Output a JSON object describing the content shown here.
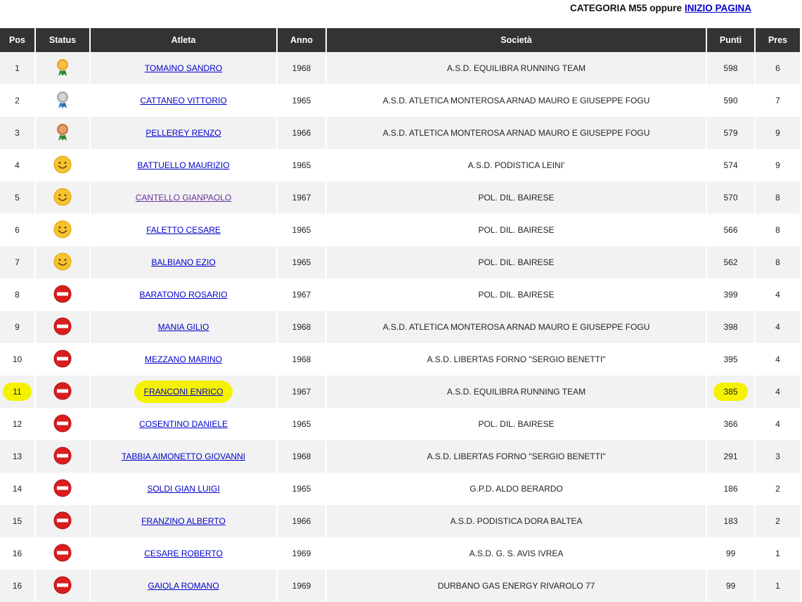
{
  "header": {
    "category_text": "CATEGORIA M55 oppure",
    "top_link": "INIZIO PAGINA"
  },
  "columns": [
    "Pos",
    "Status",
    "Atleta",
    "Anno",
    "Società",
    "Punti",
    "Pres"
  ],
  "rows": [
    {
      "pos": "1",
      "status": "gold-medal-icon",
      "athlete": "TOMAINO SANDRO",
      "year": "1968",
      "club": "A.S.D. EQUILIBRA RUNNING TEAM",
      "points": "598",
      "pres": "6"
    },
    {
      "pos": "2",
      "status": "silver-medal-icon",
      "athlete": "CATTANEO VITTORIO",
      "year": "1965",
      "club": "A.S.D. ATLETICA MONTEROSA ARNAD MAURO E GIUSEPPE FOGU",
      "points": "590",
      "pres": "7"
    },
    {
      "pos": "3",
      "status": "bronze-medal-icon",
      "athlete": "PELLEREY RENZO",
      "year": "1966",
      "club": "A.S.D. ATLETICA MONTEROSA ARNAD MAURO E GIUSEPPE FOGU",
      "points": "579",
      "pres": "9"
    },
    {
      "pos": "4",
      "status": "smiley-icon",
      "athlete": "BATTUELLO MAURIZIO",
      "year": "1965",
      "club": "A.S.D. PODISTICA LEINI'",
      "points": "574",
      "pres": "9"
    },
    {
      "pos": "5",
      "status": "smiley-icon",
      "athlete": "CANTELLO GIANPAOLO",
      "year": "1967",
      "club": "POL. DIL. BAIRESE",
      "points": "570",
      "pres": "8",
      "visited": true
    },
    {
      "pos": "6",
      "status": "smiley-icon",
      "athlete": "FALETTO CESARE",
      "year": "1965",
      "club": "POL. DIL. BAIRESE",
      "points": "566",
      "pres": "8"
    },
    {
      "pos": "7",
      "status": "smiley-icon",
      "athlete": "BALBIANO EZIO",
      "year": "1965",
      "club": "POL. DIL. BAIRESE",
      "points": "562",
      "pres": "8"
    },
    {
      "pos": "8",
      "status": "no-entry-icon",
      "athlete": "BARATONO ROSARIO",
      "year": "1967",
      "club": "POL. DIL. BAIRESE",
      "points": "399",
      "pres": "4"
    },
    {
      "pos": "9",
      "status": "no-entry-icon",
      "athlete": "MANIA GILIO",
      "year": "1968",
      "club": "A.S.D. ATLETICA MONTEROSA ARNAD MAURO E GIUSEPPE FOGU",
      "points": "398",
      "pres": "4"
    },
    {
      "pos": "10",
      "status": "no-entry-icon",
      "athlete": "MEZZANO MARINO",
      "year": "1968",
      "club": "A.S.D. LIBERTAS FORNO \"SERGIO BENETTI\"",
      "points": "395",
      "pres": "4"
    },
    {
      "pos": "11",
      "status": "no-entry-icon",
      "athlete": "FRANCONI ENRICO",
      "year": "1967",
      "club": "A.S.D. EQUILIBRA RUNNING TEAM",
      "points": "385",
      "pres": "4",
      "highlighted": true
    },
    {
      "pos": "12",
      "status": "no-entry-icon",
      "athlete": "COSENTINO DANIELE",
      "year": "1965",
      "club": "POL. DIL. BAIRESE",
      "points": "366",
      "pres": "4"
    },
    {
      "pos": "13",
      "status": "no-entry-icon",
      "athlete": "TABBIA AIMONETTO GIOVANNI",
      "year": "1968",
      "club": "A.S.D. LIBERTAS FORNO \"SERGIO BENETTI\"",
      "points": "291",
      "pres": "3"
    },
    {
      "pos": "14",
      "status": "no-entry-icon",
      "athlete": "SOLDI GIAN LUIGI",
      "year": "1965",
      "club": "G.P.D. ALDO BERARDO",
      "points": "186",
      "pres": "2"
    },
    {
      "pos": "15",
      "status": "no-entry-icon",
      "athlete": "FRANZINO ALBERTO",
      "year": "1966",
      "club": "A.S.D. PODISTICA DORA BALTEA",
      "points": "183",
      "pres": "2"
    },
    {
      "pos": "16",
      "status": "no-entry-icon",
      "athlete": "CESARE ROBERTO",
      "year": "1969",
      "club": "A.S.D. G. S. AVIS IVREA",
      "points": "99",
      "pres": "1"
    },
    {
      "pos": "16",
      "status": "no-entry-icon",
      "athlete": "GAIOLA ROMANO",
      "year": "1969",
      "club": "DURBANO GAS ENERGY RIVAROLO 77",
      "points": "99",
      "pres": "1"
    }
  ],
  "colors": {
    "header_bg": "#333333",
    "row_alt_bg": "#f2f2f2",
    "link": "#0000cc",
    "visited_link": "#663399",
    "highlight": "#f5f200"
  }
}
